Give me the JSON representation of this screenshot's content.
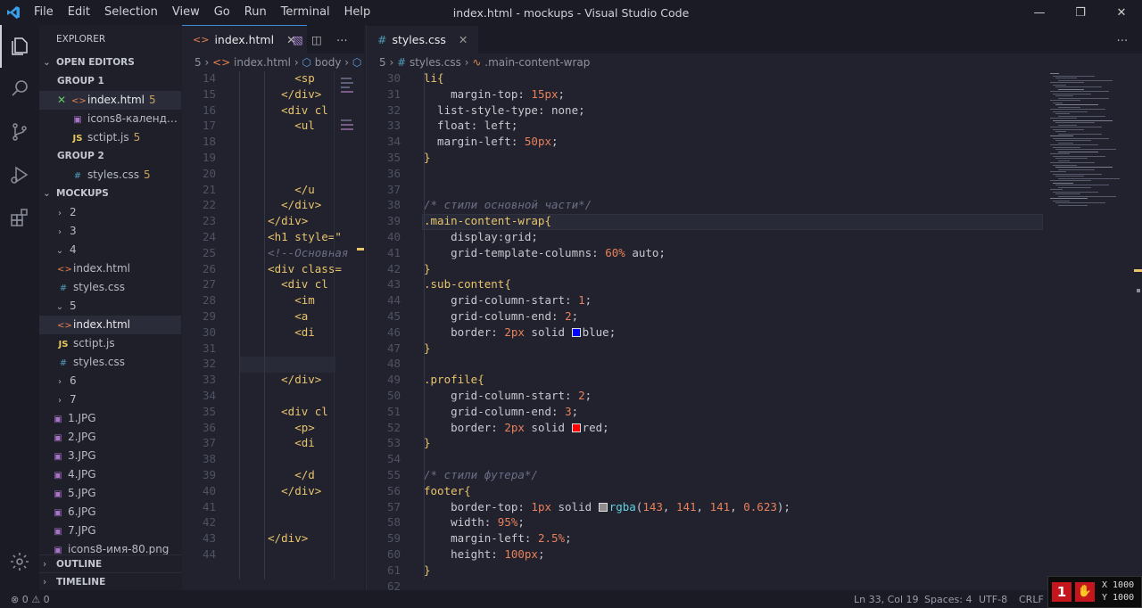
{
  "window": {
    "title": "index.html - mockups - Visual Studio Code"
  },
  "menu": [
    "File",
    "Edit",
    "Selection",
    "View",
    "Go",
    "Run",
    "Terminal",
    "Help"
  ],
  "sidebar": {
    "header": "EXPLORER",
    "open_editors": "OPEN EDITORS",
    "group1": "GROUP 1",
    "group1_items": [
      {
        "name": "index.html",
        "badge": "5",
        "icon": "<>"
      },
      {
        "name": "icons8-календар...",
        "badge": "",
        "icon": "img"
      },
      {
        "name": "sctipt.js",
        "badge": "5",
        "icon": "JS"
      }
    ],
    "group2": "GROUP 2",
    "group2_items": [
      {
        "name": "styles.css",
        "badge": "5",
        "icon": "#"
      }
    ],
    "mockups": "MOCKUPS",
    "tree": [
      {
        "label": "2",
        "kind": "folder",
        "open": false
      },
      {
        "label": "3",
        "kind": "folder",
        "open": false
      },
      {
        "label": "4",
        "kind": "folder",
        "open": true
      },
      {
        "label": "index.html",
        "kind": "html"
      },
      {
        "label": "styles.css",
        "kind": "css"
      },
      {
        "label": "5",
        "kind": "folder",
        "open": true
      },
      {
        "label": "index.html",
        "kind": "html",
        "selected": true
      },
      {
        "label": "sctipt.js",
        "kind": "js"
      },
      {
        "label": "styles.css",
        "kind": "css"
      },
      {
        "label": "6",
        "kind": "folder",
        "open": false
      },
      {
        "label": "7",
        "kind": "folder",
        "open": false
      },
      {
        "label": "1.JPG",
        "kind": "img"
      },
      {
        "label": "2.JPG",
        "kind": "img"
      },
      {
        "label": "3.JPG",
        "kind": "img"
      },
      {
        "label": "4.JPG",
        "kind": "img"
      },
      {
        "label": "5.JPG",
        "kind": "img"
      },
      {
        "label": "6.JPG",
        "kind": "img"
      },
      {
        "label": "7.JPG",
        "kind": "img"
      },
      {
        "label": "icons8-имя-80.png",
        "kind": "img"
      }
    ],
    "outline": "OUTLINE",
    "timeline": "TIMELINE"
  },
  "editor1": {
    "tab": "index.html",
    "breadcrumb": [
      "5",
      "index.html",
      "body"
    ],
    "first_line": 14,
    "lines": [
      "        <sp",
      "      </div>",
      "      <div cl",
      "        <ul",
      "",
      "",
      "",
      "        </u",
      "      </div>",
      "    </div>",
      "    <h1 style=\"",
      "    <!--Основная",
      "    <div class=",
      "      <div cl",
      "        <im",
      "        <a",
      "        <di",
      "",
      "        </d",
      "      </div>",
      "",
      "      <div cl",
      "        <p>",
      "        <di",
      "",
      "        </d",
      "      </div>",
      "",
      "",
      "    </div>",
      ""
    ]
  },
  "editor2": {
    "tab": "styles.css",
    "breadcrumb": [
      "5",
      "styles.css",
      ".main-content-wrap"
    ],
    "first_line": 30
  },
  "status": {
    "errors": "0",
    "warnings": "0",
    "position": "Ln 33, Col 19",
    "spaces": "Spaces: 4",
    "encoding": "UTF-8",
    "eol": "CRLF",
    "coords_x": "X 1000",
    "coords_y": "Y 1000"
  },
  "colors": {
    "accent": "#3d8bd9",
    "bg": "#21222d",
    "sidebar": "#1e1f29"
  }
}
